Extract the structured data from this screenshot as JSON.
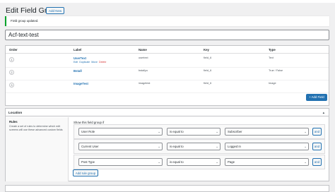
{
  "header": {
    "title": "Edit Field Group",
    "add_new_label": "Add New"
  },
  "notice": {
    "text": "Field group updated."
  },
  "title_field": {
    "value": "Acf-text-test"
  },
  "fields_table": {
    "columns": [
      "Order",
      "Label",
      "Name",
      "Key",
      "Type"
    ],
    "rows": [
      {
        "order": "1",
        "label": "UserText",
        "name": "usertext",
        "key": "field_6",
        "type": "Text",
        "actions": {
          "edit": "Edit",
          "duplicate": "Duplicate",
          "move": "Move",
          "delete": "Delete"
        }
      },
      {
        "order": "2",
        "label": "Bstall",
        "name": "bstallyu",
        "key": "field_6",
        "type": "True / False"
      },
      {
        "order": "3",
        "label": "ImageTest",
        "name": "imagetest",
        "key": "field_6",
        "type": "Image"
      }
    ],
    "add_field_label": "+ Add Field"
  },
  "location": {
    "title": "Location",
    "rules_title": "Rules",
    "rules_desc": "Create a set of rules to determine which edit screens will use these advanced custom fields",
    "show_if": "Show this field group if",
    "groups": [
      {
        "param": "User Role",
        "operator": "is equal to",
        "value": "Subscriber",
        "and": "and"
      },
      {
        "param": "Current User",
        "operator": "is equal to",
        "value": "Logged in",
        "and": "and"
      },
      {
        "param": "Post Type",
        "operator": "is equal to",
        "value": "Page",
        "and": "and"
      }
    ],
    "or_label": "or",
    "add_rule_group_label": "Add rule group"
  },
  "colors": {
    "primary": "#2271b1",
    "success": "#00a32a",
    "danger": "#d63638"
  }
}
